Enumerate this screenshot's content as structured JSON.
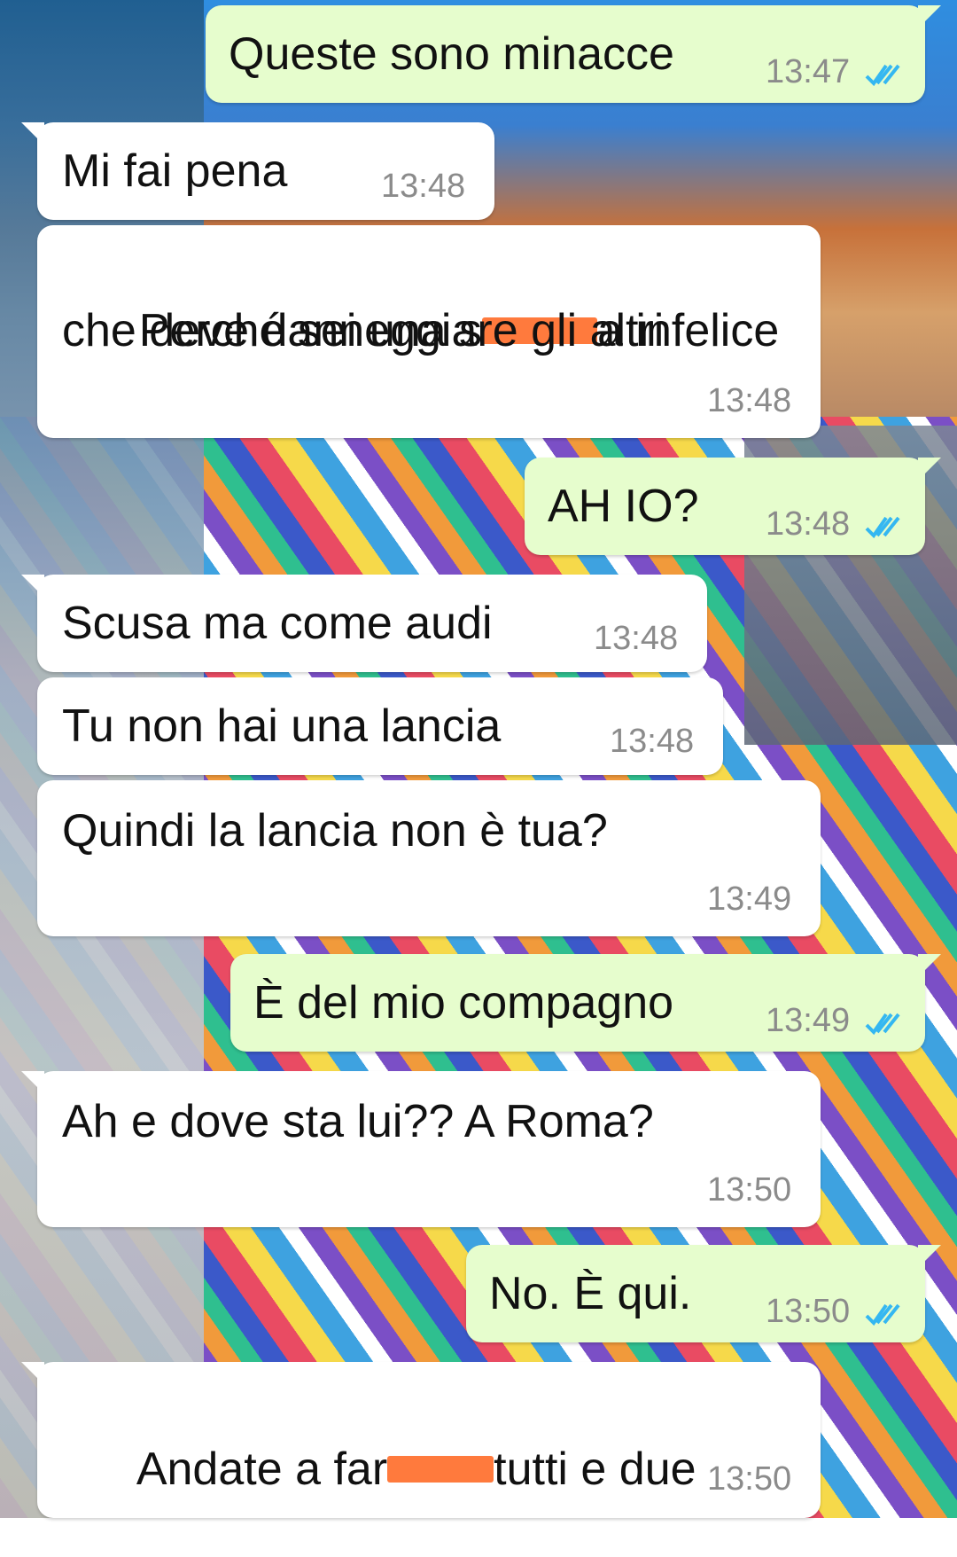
{
  "colors": {
    "incoming_bubble": "#ffffff",
    "outgoing_bubble": "#e6fdcd",
    "timestamp": "#8b8b8b",
    "read_check": "#34b7f1",
    "redaction": "#ff7a3d"
  },
  "icons": {
    "read_receipt": "double-check-icon"
  },
  "messages": [
    {
      "direction": "out",
      "text": "Queste sono minacce",
      "time": "13:47",
      "read": true
    },
    {
      "direction": "in",
      "text": "Mi fai pena",
      "time": "13:48"
    },
    {
      "direction": "in",
      "text_before": "Perché sei una s",
      "text_after": "a infelice",
      "line2": "che deve danneggiare gli altri",
      "time": "13:48",
      "redacted": true
    },
    {
      "direction": "out",
      "text": "AH IO?",
      "time": "13:48",
      "read": true
    },
    {
      "direction": "in",
      "text": "Scusa ma come audi",
      "time": "13:48"
    },
    {
      "direction": "in",
      "text": "Tu non hai una lancia",
      "time": "13:48"
    },
    {
      "direction": "in",
      "text": "Quindi la lancia non è tua?",
      "time": "13:49"
    },
    {
      "direction": "out",
      "text": "È del mio compagno",
      "time": "13:49",
      "read": true
    },
    {
      "direction": "in",
      "text": "Ah e dove sta lui?? A Roma?",
      "time": "13:50"
    },
    {
      "direction": "out",
      "text": "No. È qui.",
      "time": "13:50",
      "read": true
    },
    {
      "direction": "in",
      "text_before": "Andate a far",
      "text_after": "tutti e due",
      "time": "13:50",
      "redacted": true
    }
  ]
}
